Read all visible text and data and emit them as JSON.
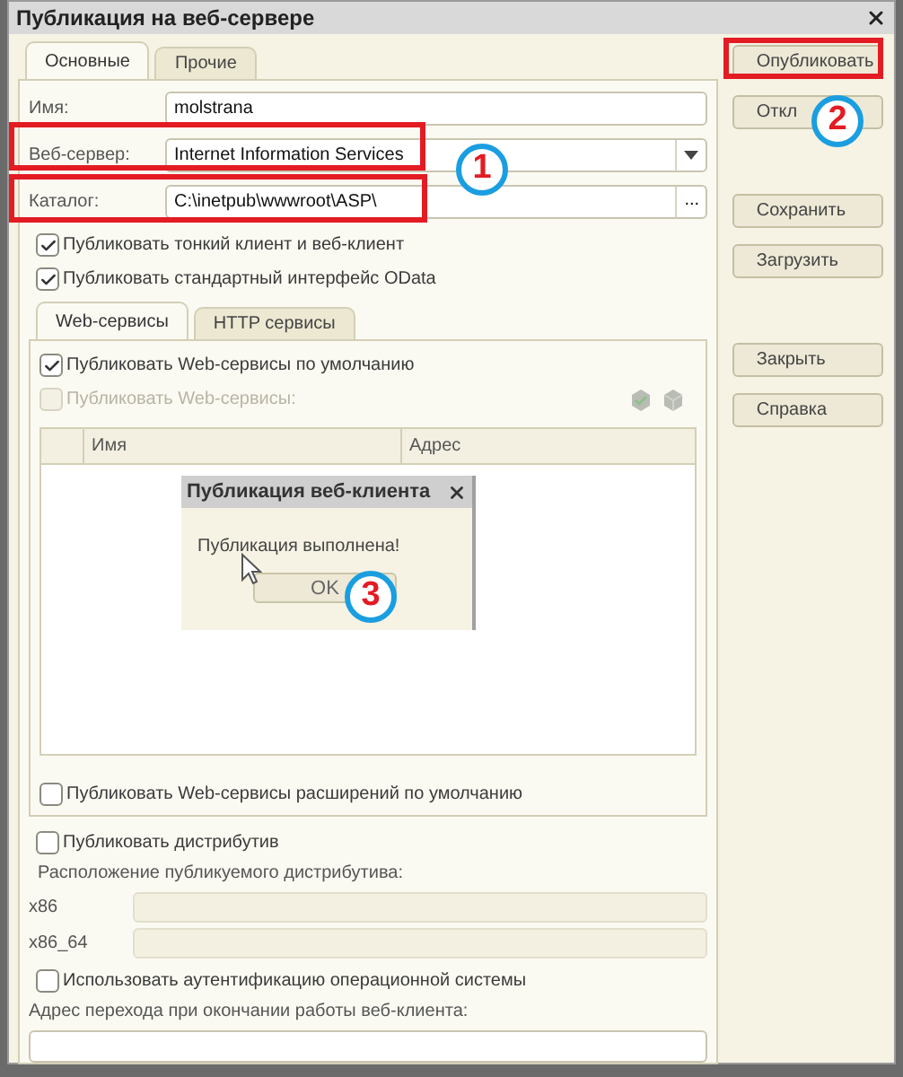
{
  "window": {
    "title": "Публикация на веб-сервере"
  },
  "tabs": [
    {
      "label": "Основные",
      "selected": true
    },
    {
      "label": "Прочие",
      "selected": false
    }
  ],
  "fields": [
    {
      "kind": "text",
      "label": "Имя:",
      "value": "molstrana"
    },
    {
      "kind": "dropdown",
      "label": "Веб-сервер:",
      "value": "Internet Information Services"
    },
    {
      "kind": "browse",
      "label": "Каталог:",
      "value": "C:\\inetpub\\wwwroot\\ASP\\",
      "button": "..."
    }
  ],
  "options": [
    {
      "label": "Публиковать тонкий клиент и веб-клиент",
      "checked": true
    },
    {
      "label": "Публиковать стандартный интерфейс OData",
      "checked": true
    }
  ],
  "inner_tabs": [
    {
      "label": "Web-сервисы",
      "selected": true
    },
    {
      "label": "HTTP сервисы",
      "selected": false
    }
  ],
  "web_services": {
    "options": [
      {
        "label": "Публиковать Web-сервисы по умолчанию",
        "checked": true,
        "disabled": false
      },
      {
        "label": "Публиковать Web-сервисы:",
        "checked": false,
        "disabled": true
      }
    ],
    "table": {
      "columns": [
        "Имя",
        "Адрес"
      ]
    },
    "footer_option": {
      "label": "Публиковать Web-сервисы расширений по умолчанию",
      "checked": false
    }
  },
  "distribution": {
    "option": {
      "label": "Публиковать дистрибутив",
      "checked": false
    },
    "location_label": "Расположение публикуемого дистрибутива:",
    "fields": [
      {
        "label": "x86"
      },
      {
        "label": "x86_64"
      }
    ]
  },
  "os_auth": {
    "label": "Использовать аутентификацию операционной системы",
    "checked": false
  },
  "exit_address": {
    "label": "Адрес перехода при окончании работы веб-клиента:"
  },
  "button_groups": [
    [
      "Опубликовать",
      "Откл"
    ],
    [
      "Сохранить",
      "Загрузить"
    ],
    [
      "Закрыть",
      "Справка"
    ]
  ],
  "dialog": {
    "title": "Публикация веб-клиента",
    "message": "Публикация выполнена!",
    "button": "OK"
  },
  "annotations": [
    {
      "number": "1"
    },
    {
      "number": "2"
    },
    {
      "number": "3"
    }
  ]
}
